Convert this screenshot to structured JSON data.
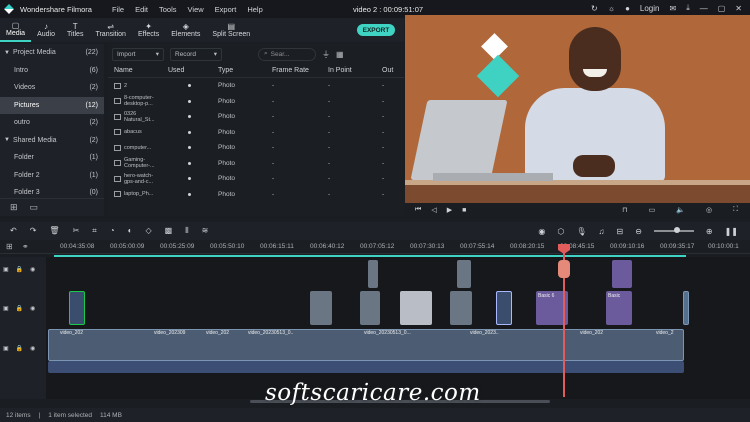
{
  "app": {
    "title": "Wondershare Filmora",
    "menu": [
      "File",
      "Edit",
      "Tools",
      "View",
      "Export",
      "Help"
    ],
    "project_title": "video 2 : 00:09:51:07",
    "login_label": "Login"
  },
  "toolbar": {
    "tools": [
      {
        "icon": "folder-icon",
        "glyph": "▢",
        "label": "Media"
      },
      {
        "icon": "music-icon",
        "glyph": "♪",
        "label": "Audio"
      },
      {
        "icon": "text-icon",
        "glyph": "T",
        "label": "Titles"
      },
      {
        "icon": "transition-icon",
        "glyph": "⇌",
        "label": "Transition"
      },
      {
        "icon": "effects-icon",
        "glyph": "✦",
        "label": "Effects"
      },
      {
        "icon": "elements-icon",
        "glyph": "◈",
        "label": "Elements"
      },
      {
        "icon": "split-screen-icon",
        "glyph": "▤",
        "label": "Split Screen"
      }
    ]
  },
  "tree": {
    "items": [
      {
        "label": "Project Media",
        "count": "(22)",
        "caret": "▼"
      },
      {
        "label": "Intro",
        "count": "(6)"
      },
      {
        "label": "Videos",
        "count": "(2)"
      },
      {
        "label": "Pictures",
        "count": "(12)"
      },
      {
        "label": "outro",
        "count": "(2)"
      },
      {
        "label": "Shared Media",
        "count": "(2)",
        "caret": "▼"
      },
      {
        "label": "Folder",
        "count": "(1)"
      },
      {
        "label": "Folder 2",
        "count": "(1)"
      },
      {
        "label": "Folder 3",
        "count": "(0)"
      }
    ]
  },
  "media": {
    "import_label": "Import",
    "record_label": "Record",
    "search_placeholder": "Sear...",
    "export_label": "EXPORT",
    "columns": [
      "Name",
      "Used",
      "Type",
      "Frame Rate",
      "In Point",
      "Out"
    ],
    "rows": [
      {
        "name": "2",
        "type": "Photo",
        "fr": "-",
        "in": "-",
        "out": "-"
      },
      {
        "name": "8-computer-\ndesktop-p...",
        "type": "Photo",
        "fr": "-",
        "in": "-",
        "out": "-"
      },
      {
        "name": "0326\nNatural_St...",
        "type": "Photo",
        "fr": "-",
        "in": "-",
        "out": "-"
      },
      {
        "name": "abacus",
        "type": "Photo",
        "fr": "-",
        "in": "-",
        "out": "-"
      },
      {
        "name": "computer...",
        "type": "Photo",
        "fr": "-",
        "in": "-",
        "out": "-"
      },
      {
        "name": "Gaming-\nComputer-...",
        "type": "Photo",
        "fr": "-",
        "in": "-",
        "out": "-"
      },
      {
        "name": "hero-watch-\ngps-and-c...",
        "type": "Photo",
        "fr": "-",
        "in": "-",
        "out": "-"
      },
      {
        "name": "laptop_Ph...",
        "type": "Photo",
        "fr": "-",
        "in": "-",
        "out": "-"
      }
    ]
  },
  "timeline": {
    "ticks": [
      "00:04:35:08",
      "00:05:00:09",
      "00:05:25:09",
      "00:05:50:10",
      "00:06:15:11",
      "00:06:40:12",
      "00:07:05:12",
      "00:07:30:13",
      "00:07:55:14",
      "00:08:20:15",
      "00:08:45:15",
      "00:09:10:16",
      "00:09:35:17",
      "00:10:00:1"
    ],
    "clip_labels": [
      "video_202",
      "video_202309",
      "video_202",
      "video_20230513_0..",
      "video_20230513_0...",
      "video_2023..",
      "video_202",
      "video_2",
      "Basic 6",
      "Basic"
    ]
  },
  "status": {
    "items": "12 items",
    "selected": "1 item selected",
    "size": "114 MB"
  },
  "watermark": "softscaricare.com"
}
